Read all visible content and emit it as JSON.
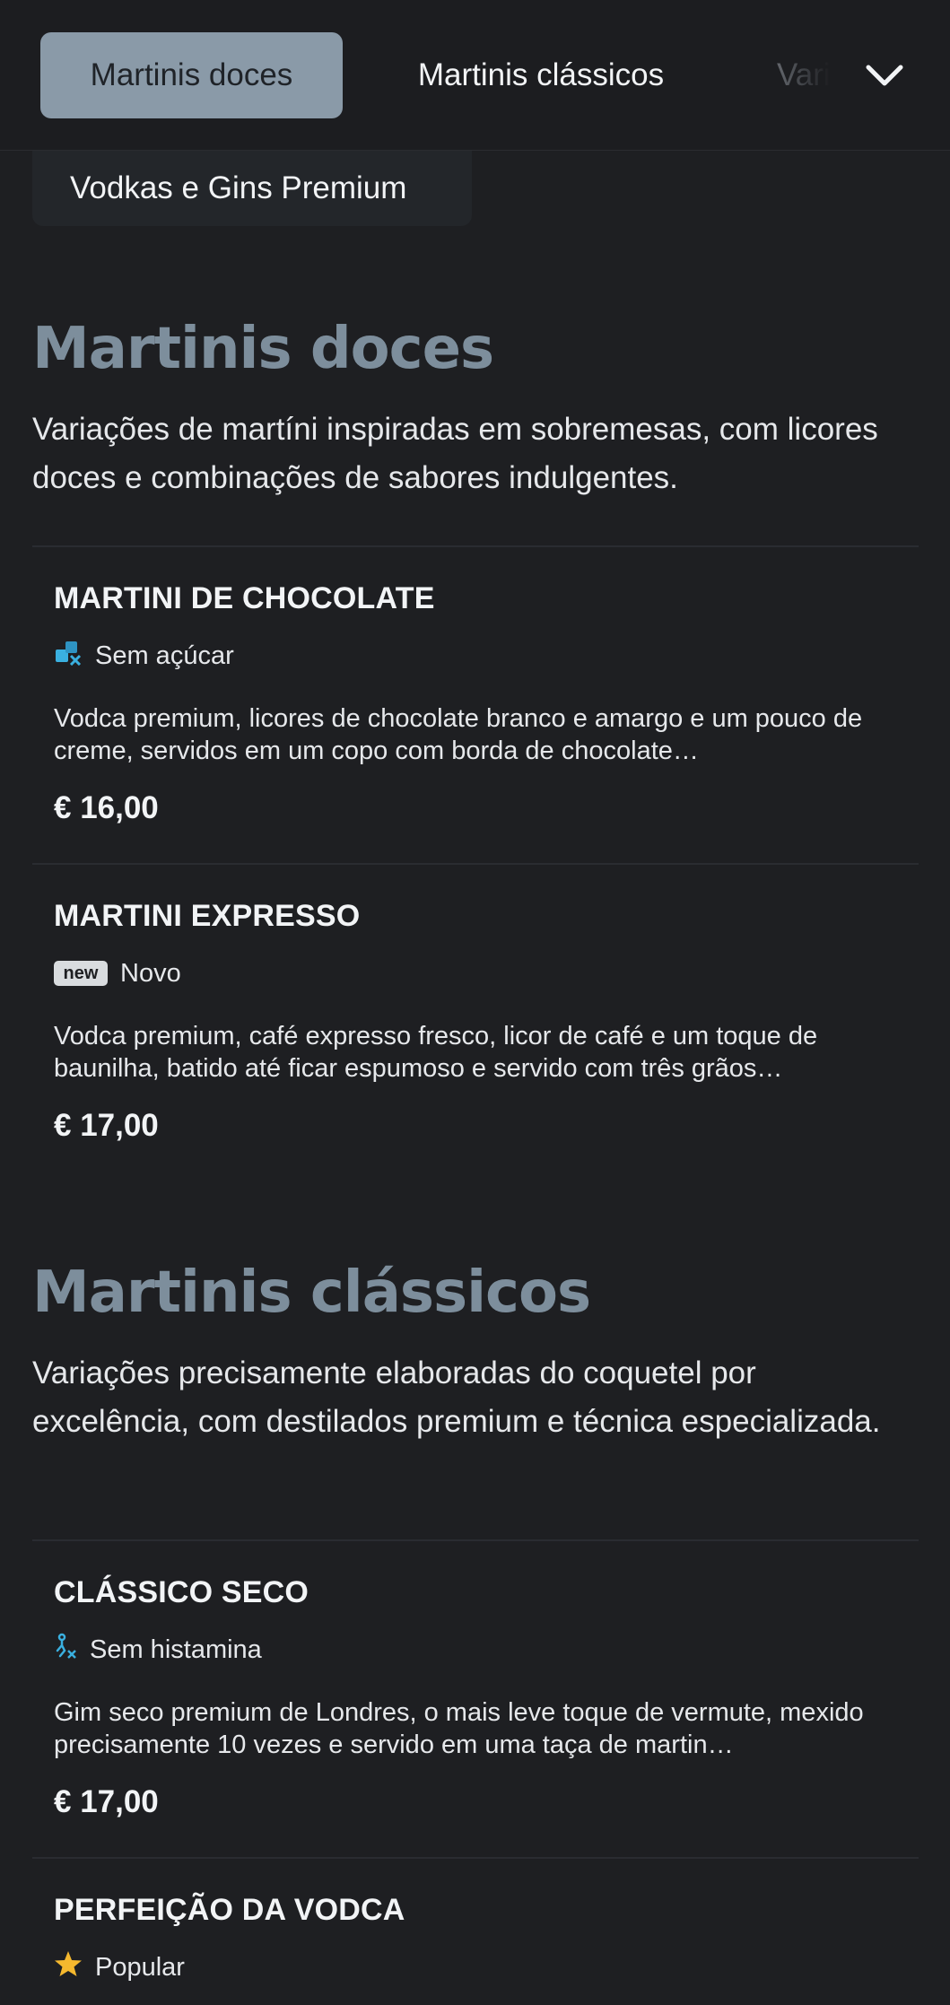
{
  "tabs": [
    {
      "label": "Martinis doces",
      "active": true
    },
    {
      "label": "Martinis clássicos",
      "active": false
    },
    {
      "label": "Vari",
      "active": false
    }
  ],
  "dropdown": {
    "icon": "chevron-down-icon",
    "overflow_item": "Vodkas e Gins Premium"
  },
  "sections": [
    {
      "title": "Martinis doces",
      "description": "Variações de martíni inspiradas em sobremesas, com licores doces e combinações de sabores indulgentes.",
      "items": [
        {
          "name": "MARTINI DE CHOCOLATE",
          "tag_icon": "sugar-free-icon",
          "tag": "Sem açúcar",
          "description": "Vodca premium, licores de chocolate branco e amargo e um pouco de creme, servidos em um copo com borda de chocolate…",
          "price": "€ 16,00"
        },
        {
          "name": "MARTINI EXPRESSO",
          "tag_icon": "new-badge-icon",
          "badge_text": "new",
          "tag": "Novo",
          "description": "Vodca premium, café expresso fresco, licor de café e um toque de baunilha, batido até ficar espumoso e servido com três grãos…",
          "price": "€ 17,00"
        }
      ]
    },
    {
      "title": "Martinis clássicos",
      "description": "Variações precisamente elaboradas do coquetel por excelência, com destilados premium e técnica especializada.",
      "items": [
        {
          "name": "CLÁSSICO SECO",
          "tag_icon": "histamine-free-icon",
          "tag": "Sem histamina",
          "description": "Gim seco premium de Londres, o mais leve toque de vermute, mexido precisamente 10 vezes e servido em uma taça de martin…",
          "price": "€ 17,00"
        },
        {
          "name": "PERFEIÇÃO DA VODCA",
          "tag_icon": "star-icon",
          "tag": "Popular"
        }
      ]
    }
  ],
  "colors": {
    "background": "#1e1f22",
    "active_tab": "#8a9aa8",
    "section_title": "#7d8e9c",
    "icon_blue": "#3ab0e0",
    "star": "#f5b82e"
  }
}
